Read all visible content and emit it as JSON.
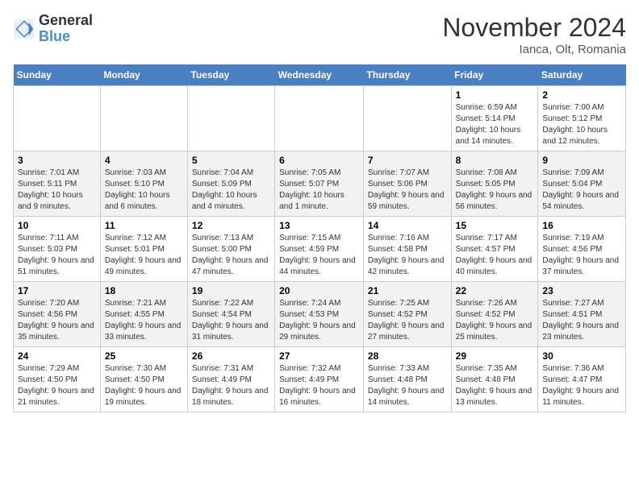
{
  "header": {
    "logo_line1": "General",
    "logo_line2": "Blue",
    "month": "November 2024",
    "location": "Ianca, Olt, Romania"
  },
  "weekdays": [
    "Sunday",
    "Monday",
    "Tuesday",
    "Wednesday",
    "Thursday",
    "Friday",
    "Saturday"
  ],
  "weeks": [
    [
      {
        "day": "",
        "info": ""
      },
      {
        "day": "",
        "info": ""
      },
      {
        "day": "",
        "info": ""
      },
      {
        "day": "",
        "info": ""
      },
      {
        "day": "",
        "info": ""
      },
      {
        "day": "1",
        "info": "Sunrise: 6:59 AM\nSunset: 5:14 PM\nDaylight: 10 hours and 14 minutes."
      },
      {
        "day": "2",
        "info": "Sunrise: 7:00 AM\nSunset: 5:12 PM\nDaylight: 10 hours and 12 minutes."
      }
    ],
    [
      {
        "day": "3",
        "info": "Sunrise: 7:01 AM\nSunset: 5:11 PM\nDaylight: 10 hours and 9 minutes."
      },
      {
        "day": "4",
        "info": "Sunrise: 7:03 AM\nSunset: 5:10 PM\nDaylight: 10 hours and 6 minutes."
      },
      {
        "day": "5",
        "info": "Sunrise: 7:04 AM\nSunset: 5:09 PM\nDaylight: 10 hours and 4 minutes."
      },
      {
        "day": "6",
        "info": "Sunrise: 7:05 AM\nSunset: 5:07 PM\nDaylight: 10 hours and 1 minute."
      },
      {
        "day": "7",
        "info": "Sunrise: 7:07 AM\nSunset: 5:06 PM\nDaylight: 9 hours and 59 minutes."
      },
      {
        "day": "8",
        "info": "Sunrise: 7:08 AM\nSunset: 5:05 PM\nDaylight: 9 hours and 56 minutes."
      },
      {
        "day": "9",
        "info": "Sunrise: 7:09 AM\nSunset: 5:04 PM\nDaylight: 9 hours and 54 minutes."
      }
    ],
    [
      {
        "day": "10",
        "info": "Sunrise: 7:11 AM\nSunset: 5:03 PM\nDaylight: 9 hours and 51 minutes."
      },
      {
        "day": "11",
        "info": "Sunrise: 7:12 AM\nSunset: 5:01 PM\nDaylight: 9 hours and 49 minutes."
      },
      {
        "day": "12",
        "info": "Sunrise: 7:13 AM\nSunset: 5:00 PM\nDaylight: 9 hours and 47 minutes."
      },
      {
        "day": "13",
        "info": "Sunrise: 7:15 AM\nSunset: 4:59 PM\nDaylight: 9 hours and 44 minutes."
      },
      {
        "day": "14",
        "info": "Sunrise: 7:16 AM\nSunset: 4:58 PM\nDaylight: 9 hours and 42 minutes."
      },
      {
        "day": "15",
        "info": "Sunrise: 7:17 AM\nSunset: 4:57 PM\nDaylight: 9 hours and 40 minutes."
      },
      {
        "day": "16",
        "info": "Sunrise: 7:19 AM\nSunset: 4:56 PM\nDaylight: 9 hours and 37 minutes."
      }
    ],
    [
      {
        "day": "17",
        "info": "Sunrise: 7:20 AM\nSunset: 4:56 PM\nDaylight: 9 hours and 35 minutes."
      },
      {
        "day": "18",
        "info": "Sunrise: 7:21 AM\nSunset: 4:55 PM\nDaylight: 9 hours and 33 minutes."
      },
      {
        "day": "19",
        "info": "Sunrise: 7:22 AM\nSunset: 4:54 PM\nDaylight: 9 hours and 31 minutes."
      },
      {
        "day": "20",
        "info": "Sunrise: 7:24 AM\nSunset: 4:53 PM\nDaylight: 9 hours and 29 minutes."
      },
      {
        "day": "21",
        "info": "Sunrise: 7:25 AM\nSunset: 4:52 PM\nDaylight: 9 hours and 27 minutes."
      },
      {
        "day": "22",
        "info": "Sunrise: 7:26 AM\nSunset: 4:52 PM\nDaylight: 9 hours and 25 minutes."
      },
      {
        "day": "23",
        "info": "Sunrise: 7:27 AM\nSunset: 4:51 PM\nDaylight: 9 hours and 23 minutes."
      }
    ],
    [
      {
        "day": "24",
        "info": "Sunrise: 7:29 AM\nSunset: 4:50 PM\nDaylight: 9 hours and 21 minutes."
      },
      {
        "day": "25",
        "info": "Sunrise: 7:30 AM\nSunset: 4:50 PM\nDaylight: 9 hours and 19 minutes."
      },
      {
        "day": "26",
        "info": "Sunrise: 7:31 AM\nSunset: 4:49 PM\nDaylight: 9 hours and 18 minutes."
      },
      {
        "day": "27",
        "info": "Sunrise: 7:32 AM\nSunset: 4:49 PM\nDaylight: 9 hours and 16 minutes."
      },
      {
        "day": "28",
        "info": "Sunrise: 7:33 AM\nSunset: 4:48 PM\nDaylight: 9 hours and 14 minutes."
      },
      {
        "day": "29",
        "info": "Sunrise: 7:35 AM\nSunset: 4:48 PM\nDaylight: 9 hours and 13 minutes."
      },
      {
        "day": "30",
        "info": "Sunrise: 7:36 AM\nSunset: 4:47 PM\nDaylight: 9 hours and 11 minutes."
      }
    ]
  ]
}
